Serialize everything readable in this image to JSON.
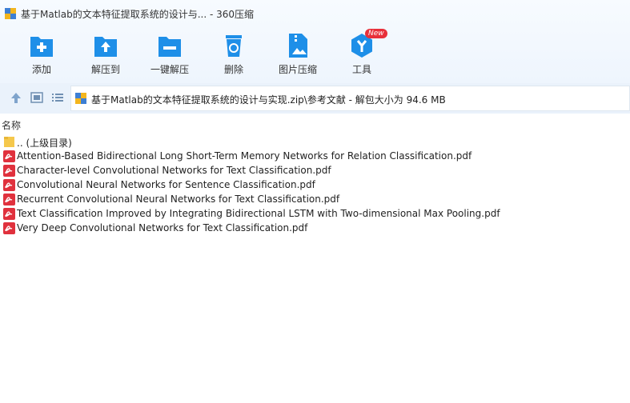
{
  "window": {
    "title": "基于Matlab的文本特征提取系统的设计与... - 360压缩"
  },
  "toolbar": {
    "items": [
      {
        "label": "添加",
        "icon": "add-folder-icon"
      },
      {
        "label": "解压到",
        "icon": "extract-to-icon"
      },
      {
        "label": "一键解压",
        "icon": "one-click-extract-icon"
      },
      {
        "label": "删除",
        "icon": "recycle-bin-icon"
      },
      {
        "label": "图片压缩",
        "icon": "image-compress-icon"
      },
      {
        "label": "工具",
        "icon": "tools-icon",
        "badge": "New"
      }
    ]
  },
  "nav": {
    "path": "基于Matlab的文本特征提取系统的设计与实现.zip\\参考文献 - 解包大小为 94.6 MB"
  },
  "list": {
    "column_name": "名称",
    "parent": ".. (上级目录)",
    "files": [
      "Attention-Based Bidirectional Long Short-Term Memory Networks for Relation Classification.pdf",
      "Character-level Convolutional Networks for Text Classification.pdf",
      "Convolutional Neural Networks for Sentence Classification.pdf",
      "Recurrent Convolutional Neural Networks for Text Classification.pdf",
      "Text Classification Improved by Integrating Bidirectional LSTM with Two-dimensional Max Pooling.pdf",
      "Very Deep Convolutional Networks for Text Classification.pdf"
    ]
  },
  "colors": {
    "accent": "#1e8fe8",
    "pdf_red": "#e0313d",
    "folder_yellow": "#f5c84c"
  }
}
